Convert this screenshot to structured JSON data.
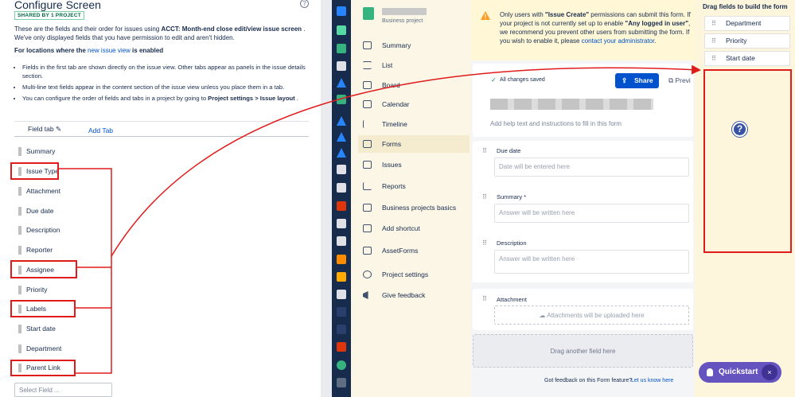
{
  "left": {
    "title": "Configure Screen",
    "help_icon": "question-circle-icon",
    "shared_badge": "SHARED BY 1 PROJECT",
    "intro_pre": "These are the fields and their order for issues using ",
    "intro_bold": "ACCT: Month-end close edit/view issue screen",
    "intro_post": " . We've only displayed fields that you have permission to edit and aren't hidden.",
    "loc_pre": "For locations where the ",
    "loc_link": "new issue view",
    "loc_post": " is enabled",
    "bullets": [
      "Fields in the first tab are shown directly on the issue view. Other tabs appear as panels in the issue details section.",
      "Multi-line text fields appear in the content section of the issue view unless you place them in a tab.",
      "You can configure the order of fields and tabs in a project by going to "
    ],
    "bullet3_bold": "Project settings > Issue layout",
    "bullet3_end": " .",
    "tab_label": "Field tab",
    "add_tab": "Add Tab",
    "fields": [
      "Summary",
      "Issue Type",
      "Attachment",
      "Due date",
      "Description",
      "Reporter",
      "Assignee",
      "Priority",
      "Labels",
      "Start date",
      "Department",
      "Parent Link"
    ],
    "select_placeholder": "Select Field ..."
  },
  "sidebar": {
    "project_type": "Business project",
    "items": [
      "Summary",
      "List",
      "Board",
      "Calendar",
      "Timeline",
      "Forms",
      "Issues",
      "Reports",
      "Business projects basics",
      "Add shortcut",
      "AssetForms",
      "Project settings",
      "Give feedback"
    ],
    "selected": "Forms"
  },
  "main": {
    "warning_pre": "Only users with ",
    "warning_b1": "\"Issue Create\"",
    "warning_mid": " permissions can submit this form. If your project is not currently set up to enable ",
    "warning_b2": "\"Any logged in user\"",
    "warning_post": ", we recommend you prevent other users from submitting the form. If you wish to enable it, please ",
    "warning_link": "contact your administrator",
    "warning_end": ".",
    "saved": "All changes saved",
    "share": "Share",
    "preview": "Previ",
    "help_placeholder": "Add help text and instructions to fill in this form",
    "questions": [
      {
        "label": "Due date",
        "placeholder": "Date will be entered here"
      },
      {
        "label": "Summary *",
        "placeholder": "Answer will be written here"
      },
      {
        "label": "Description",
        "placeholder": "Answer will be written here"
      },
      {
        "label": "Attachment",
        "placeholder": "Attachments will be uploaded here"
      }
    ],
    "drag_another": "Drag another field here",
    "feedback": "Got feedback on this Form feature?",
    "feedback_link": "Let us know here"
  },
  "right": {
    "title": "Drag fields to build the form",
    "fields": [
      "Department",
      "Priority",
      "Start date"
    ],
    "quickstart": "Quickstart",
    "close": "×"
  },
  "colors": {
    "accent": "#0052cc",
    "annotation_red": "#e01b1b",
    "quickstart": "#6554c0",
    "selected_nav": "#f5eccf"
  }
}
